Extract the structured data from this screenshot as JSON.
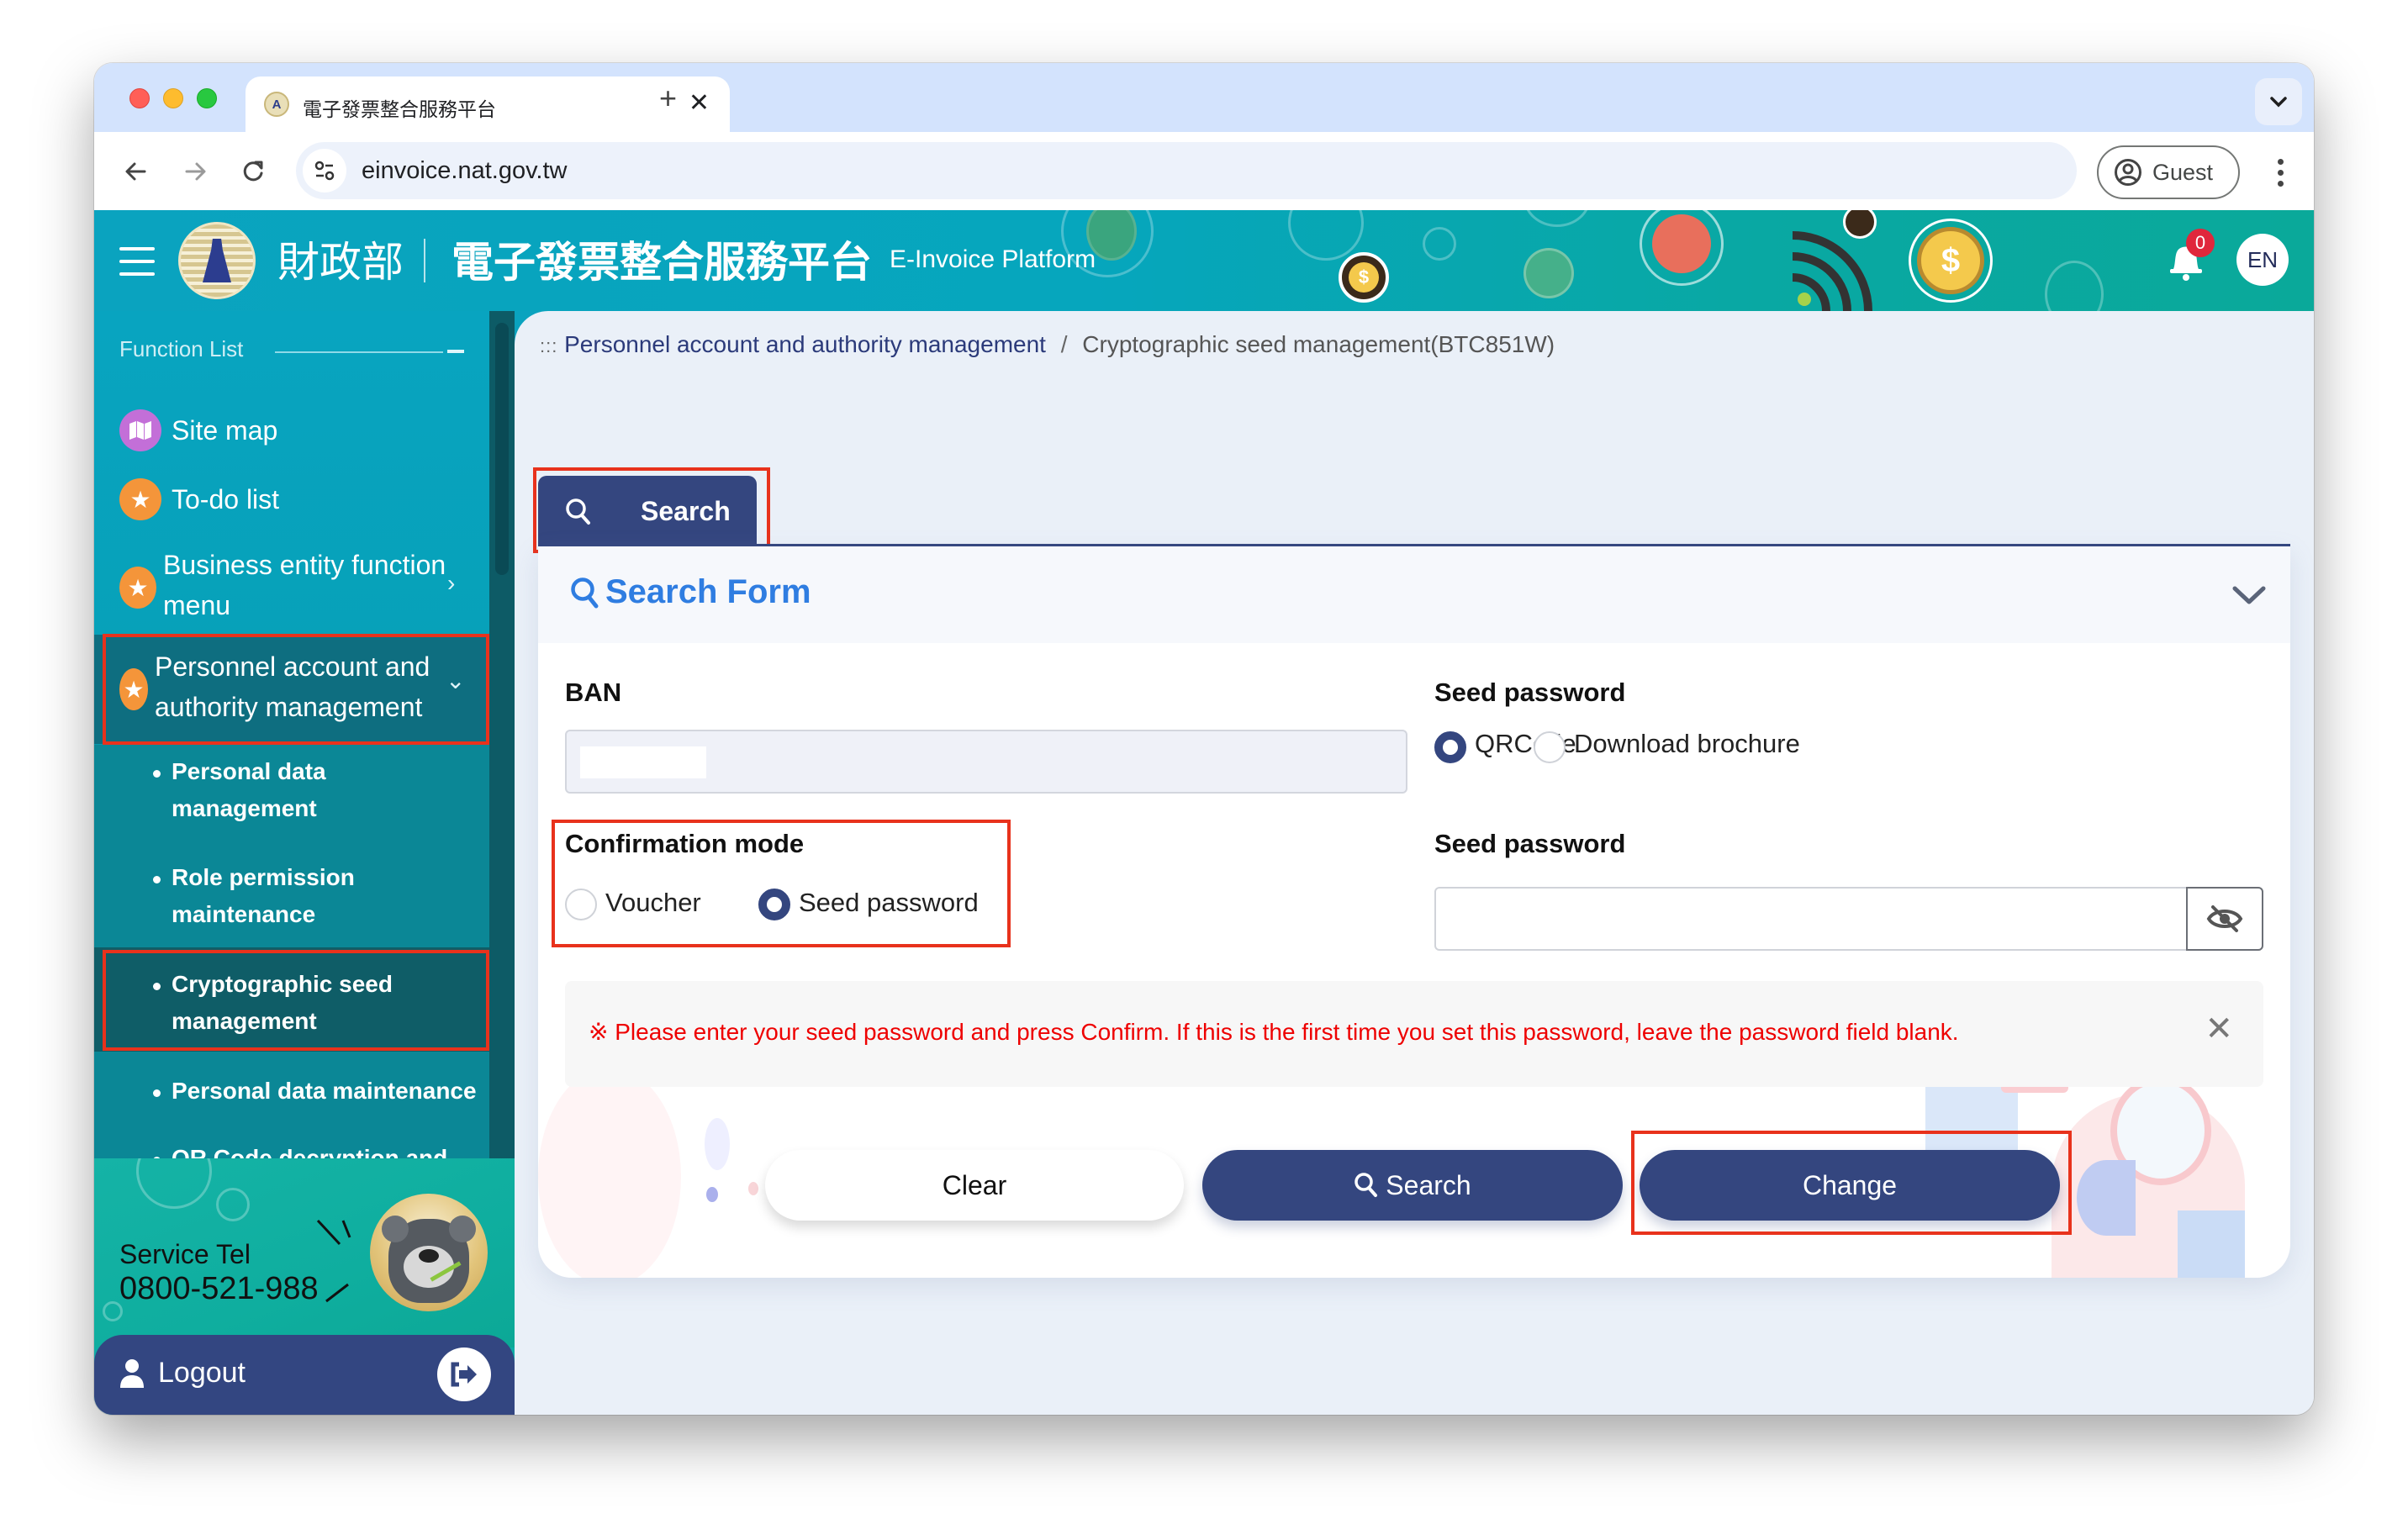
{
  "browser": {
    "tab_title": "電子發票整合服務平台",
    "url": "einvoice.nat.gov.tw",
    "profile_label": "Guest",
    "icons": {
      "back": "arrow-left-icon",
      "forward": "arrow-right-icon",
      "reload": "reload-icon",
      "site_info": "tune-icon",
      "profile": "account-circle-icon",
      "menu": "more-vert-icon",
      "tab_list": "chevron-down-icon",
      "new_tab": "plus-icon",
      "close_tab": "close-icon"
    },
    "glyphs": {
      "close_tab": "✕",
      "new_tab": "+"
    }
  },
  "header": {
    "ministry": "財政部",
    "title": "電子發票整合服務平台",
    "subtitle_en": "E-Invoice Platform",
    "notification_count": "0",
    "language_button": "EN",
    "brand_color": "#0aa3bf"
  },
  "sidebar": {
    "section_title": "Function List",
    "items": [
      {
        "label": "Site map",
        "icon": "map-icon",
        "icon_color": "#c36fd8"
      },
      {
        "label": "To-do list",
        "icon": "star-icon",
        "icon_color": "#f4953a"
      },
      {
        "label_line1": "Business entity function",
        "label_line2": "menu",
        "icon": "star-icon",
        "icon_color": "#f4953a",
        "chevron": "›"
      },
      {
        "label_line1": "Personnel account and",
        "label_line2": "authority management",
        "icon": "star-icon",
        "icon_color": "#f4953a",
        "chevron": "⌄",
        "expanded": true
      }
    ],
    "subitems": [
      {
        "line1": "Personal data",
        "line2": "management"
      },
      {
        "line1": "Role permission",
        "line2": "maintenance"
      },
      {
        "line1": "Cryptographic seed",
        "line2": "management",
        "active": true
      },
      {
        "line1": "Personal data maintenance"
      },
      {
        "line1": "QR Code decryption and"
      }
    ],
    "service_label": "Service Tel",
    "service_tel": "0800-521-988",
    "logout_label": "Logout"
  },
  "breadcrumb": {
    "prefix": ":::",
    "parent": "Personnel account and authority management",
    "separator": "/",
    "current": "Cryptographic seed management(BTC851W)"
  },
  "tabs": {
    "search_tab_label": "Search"
  },
  "form": {
    "title": "Search Form",
    "ban_label": "BAN",
    "ban_value": "",
    "confirmation_mode_label": "Confirmation mode",
    "confirmation_options": [
      {
        "label": "Voucher",
        "selected": false
      },
      {
        "label": "Seed password",
        "selected": true
      }
    ],
    "seed_password_type_label": "Seed password",
    "seed_password_type_options": [
      {
        "label": "QRCode",
        "selected": true
      },
      {
        "label": "Download brochure",
        "selected": false
      }
    ],
    "seed_password_label": "Seed password",
    "seed_password_value": "",
    "notice_mark": "※",
    "notice_text": "Please enter your seed password and press Confirm. If this is the first time you set this password, leave the password field blank.",
    "notice_close": "✕",
    "buttons": {
      "clear": "Clear",
      "search": "Search",
      "change": "Change"
    },
    "primary_color": "#34467f",
    "notice_color": "#e00000",
    "title_color": "#2f7de1"
  },
  "annotations": {
    "highlight_color": "#e8321c"
  }
}
